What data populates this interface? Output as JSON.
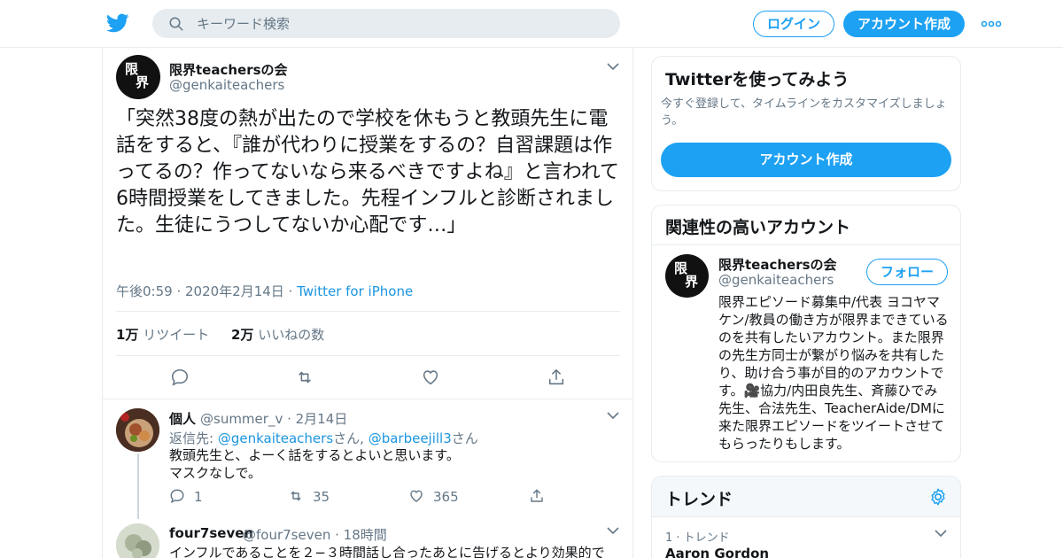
{
  "colors": {
    "brand": "#1da1f2",
    "link": "#1b95e0",
    "muted": "#657786",
    "text": "#14171a",
    "border": "#e6ecf0"
  },
  "header": {
    "logo_icon": "twitter-bird-icon",
    "search_placeholder": "キーワード検索",
    "login_label": "ログイン",
    "signup_label": "アカウント作成",
    "more_icon": "more-dots-icon"
  },
  "tweet": {
    "avatar_text_top": "限",
    "avatar_text_bottom": "界",
    "name": "限界teachersの会",
    "handle": "@genkaiteachers",
    "text": "「突然38度の熱が出たので学校を休もうと教頭先生に電話をすると、『誰が代わりに授業をするの？自習課題は作ってるの？作ってないなら来るべきですよね』と言われて6時間授業をしてきました。先程インフルと診断されました。生徒にうつしてないか心配です…」",
    "time": "午後0:59 · 2020年2月14日 · ",
    "source": "Twitter for iPhone",
    "retweet_count": "1万",
    "retweet_label": " リツイート",
    "like_count": "2万",
    "like_label": " いいねの数"
  },
  "replies": [
    {
      "name": "個人",
      "handle": "@summer_v",
      "date": " · 2月14日",
      "reply_to_prefix": "返信先: ",
      "reply_to_1": "@genkaiteachers",
      "reply_to_mid": "さん, ",
      "reply_to_2": "@barbeejill3",
      "reply_to_suffix": "さん",
      "text_line1": "教頭先生と、よーく話をするとよいと思います。",
      "text_line2": "マスクなしで。",
      "reply_count": "1",
      "retweet_count": "35",
      "like_count": "365"
    },
    {
      "name": "four7seven",
      "handle": "@four7seven",
      "date": " · 18時間",
      "text_line1": "インフルであることを２−３時間話し合ったあとに告げるとより効果的で"
    }
  ],
  "sidebar": {
    "signup_card": {
      "title": "Twitterを使ってみよう",
      "subtitle": "今すぐ登録して、タイムラインをカスタマイズしましょう。",
      "button": "アカウント作成"
    },
    "related_card": {
      "title": "関連性の高いアカウント",
      "name": "限界teachersの会",
      "handle": "@genkaiteachers",
      "follow_label": "フォロー",
      "bio": "限界エピソード募集中/代表 ヨコヤマケン/教員の働き方が限界まできているのを共有したいアカウント。また限界の先生方同士が繋がり悩みを共有したり、助け合う事が目的のアカウントです。🎥協力/内田良先生、斉藤ひでみ先生、合法先生、TeacherAide/DMに来た限界エピソードをツイートさせてもらったりもします。"
    },
    "trends_card": {
      "title": "トレンド",
      "rank_label": "1 · トレンド",
      "trend_name": "Aaron Gordon"
    }
  }
}
